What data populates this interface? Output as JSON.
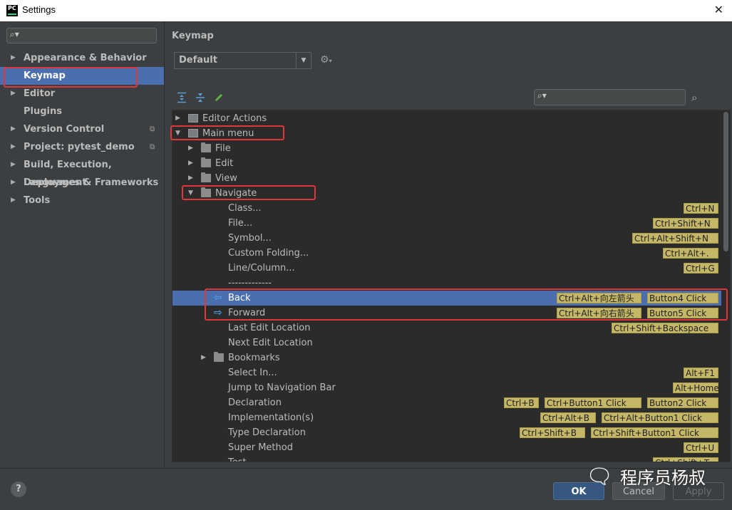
{
  "window": {
    "title": "Settings",
    "app_icon_text": "PC",
    "close_glyph": "✕"
  },
  "sidebar": {
    "search_placeholder": "",
    "items": [
      {
        "label": "Appearance & Behavior",
        "expandable": true
      },
      {
        "label": "Keymap",
        "expandable": false,
        "selected": true
      },
      {
        "label": "Editor",
        "expandable": true
      },
      {
        "label": "Plugins",
        "expandable": false
      },
      {
        "label": "Version Control",
        "expandable": true,
        "project_icon": true
      },
      {
        "label": "Project: pytest_demo",
        "expandable": true,
        "project_icon": true
      },
      {
        "label": "Build, Execution, Deployment",
        "expandable": true
      },
      {
        "label": "Languages & Frameworks",
        "expandable": true
      },
      {
        "label": "Tools",
        "expandable": true
      }
    ]
  },
  "main": {
    "title": "Keymap",
    "keymap_value": "Default",
    "search_placeholder": ""
  },
  "tree": [
    {
      "label": "Editor Actions",
      "level": 0,
      "toggle": "▶",
      "icon": "editor-actions-icon",
      "shortcuts": []
    },
    {
      "label": "Main menu",
      "level": 0,
      "toggle": "▼",
      "icon": "main-menu-icon",
      "shortcuts": []
    },
    {
      "label": "File",
      "level": 1,
      "toggle": "▶",
      "icon": "folder-icon",
      "shortcuts": []
    },
    {
      "label": "Edit",
      "level": 1,
      "toggle": "▶",
      "icon": "folder-icon",
      "shortcuts": []
    },
    {
      "label": "View",
      "level": 1,
      "toggle": "▶",
      "icon": "folder-icon",
      "shortcuts": []
    },
    {
      "label": "Navigate",
      "level": 1,
      "toggle": "▼",
      "icon": "folder-icon",
      "shortcuts": []
    },
    {
      "label": "Class...",
      "level": 3,
      "shortcuts": [
        "Ctrl+N"
      ]
    },
    {
      "label": "File...",
      "level": 3,
      "shortcuts": [
        "Ctrl+Shift+N"
      ]
    },
    {
      "label": "Symbol...",
      "level": 3,
      "shortcuts": [
        "Ctrl+Alt+Shift+N"
      ]
    },
    {
      "label": "Custom Folding...",
      "level": 3,
      "shortcuts": [
        "Ctrl+Alt+."
      ]
    },
    {
      "label": "Line/Column...",
      "level": 3,
      "shortcuts": [
        "Ctrl+G"
      ]
    },
    {
      "label": "-------------",
      "level": 3,
      "shortcuts": []
    },
    {
      "label": "Back",
      "level": 3,
      "icon": "back-arrow-icon",
      "selected": true,
      "shortcuts": [
        "Ctrl+Alt+向左箭头",
        "Button4 Click"
      ]
    },
    {
      "label": "Forward",
      "level": 3,
      "icon": "forward-arrow-icon",
      "shortcuts": [
        "Ctrl+Alt+向右箭头",
        "Button5 Click"
      ]
    },
    {
      "label": "Last Edit Location",
      "level": 3,
      "shortcuts": [
        "Ctrl+Shift+Backspace"
      ]
    },
    {
      "label": "Next Edit Location",
      "level": 3,
      "shortcuts": []
    },
    {
      "label": "Bookmarks",
      "level": 2,
      "toggle": "▶",
      "icon": "folder-icon",
      "shortcuts": []
    },
    {
      "label": "Select In...",
      "level": 3,
      "shortcuts": [
        "Alt+F1"
      ]
    },
    {
      "label": "Jump to Navigation Bar",
      "level": 3,
      "shortcuts": [
        "Alt+Home"
      ]
    },
    {
      "label": "Declaration",
      "level": 3,
      "shortcuts": [
        "Ctrl+B",
        "Ctrl+Button1 Click",
        "Button2 Click"
      ]
    },
    {
      "label": "Implementation(s)",
      "level": 3,
      "shortcuts": [
        "Ctrl+Alt+B",
        "Ctrl+Alt+Button1 Click"
      ]
    },
    {
      "label": "Type Declaration",
      "level": 3,
      "shortcuts": [
        "Ctrl+Shift+B",
        "Ctrl+Shift+Button1 Click"
      ]
    },
    {
      "label": "Super Method",
      "level": 3,
      "shortcuts": [
        "Ctrl+U"
      ]
    },
    {
      "label": "Test",
      "level": 3,
      "shortcuts": [
        "Ctrl+Shift+T"
      ]
    }
  ],
  "footer": {
    "help": "?",
    "ok": "OK",
    "cancel": "Cancel",
    "apply": "Apply"
  },
  "watermark": {
    "text": "程序员杨叔"
  },
  "colors": {
    "selection": "#4b6eaf",
    "shortcut_badge": "#c4b767",
    "annotation_box": "#e0373a",
    "ok_button": "#365880"
  }
}
